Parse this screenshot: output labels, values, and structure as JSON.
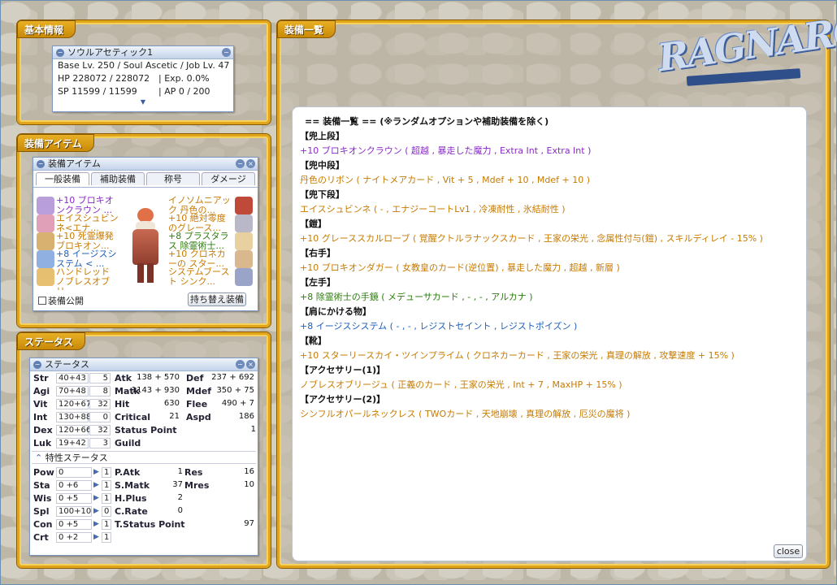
{
  "basic": {
    "frame_title": "基本情報",
    "window_title": "ソウルアセティック1",
    "lines": [
      "Base Lv. 250 / Soul Ascetic / Job Lv. 47",
      "HP 228072 / 228072",
      "| Exp. 0.0%",
      "SP 11599 / 11599",
      "| AP 0 / 200"
    ]
  },
  "equip_item": {
    "frame_title": "装備アイテム",
    "window_title": "装備アイテム",
    "tabs": [
      "一般装備",
      "補助装備",
      "称号",
      "ダメージ"
    ],
    "left_items": [
      {
        "text": "+10 ブロキオンクラウン ...",
        "color": "#8a2ac8",
        "icon": "crown-icon"
      },
      {
        "text": "エイスシュビンネ<エナ...",
        "color": "#c77a00",
        "icon": "ribbon-icon"
      },
      {
        "text": "+10 死霊爆発ブロキオン...",
        "color": "#c77a00",
        "icon": "dagger-icon"
      },
      {
        "text": "+8 イージスシステム < ...",
        "color": "#1f60b8",
        "icon": "cape-icon"
      },
      {
        "text": "ハンドレッド ノブレスオブリ...",
        "color": "#c77a00",
        "icon": "ring-icon"
      }
    ],
    "right_items": [
      {
        "text": "イノソムニアック 丹色の...",
        "color": "#c77a00",
        "icon": "robe-icon"
      },
      {
        "text": "+10 絶対零度のグレース...",
        "color": "#c77a00",
        "icon": "armor-icon"
      },
      {
        "text": "+8 プラスタラス 除霊術士...",
        "color": "#2e7d10",
        "icon": "glove-icon"
      },
      {
        "text": "+10 クロネカーの スター...",
        "color": "#c77a00",
        "icon": "shoe-icon"
      },
      {
        "text": "システムブースト シンク...",
        "color": "#c77a00",
        "icon": "necklace-icon"
      }
    ],
    "public_label": "装備公開",
    "switch_button": "持ち替え装備"
  },
  "status": {
    "frame_title": "ステータス",
    "window_title": "ステータス",
    "base_stats": [
      {
        "name": "Str",
        "value": "40+43",
        "bonus": "5"
      },
      {
        "name": "Agi",
        "value": "70+48",
        "bonus": "8"
      },
      {
        "name": "Vit",
        "value": "120+67",
        "bonus": "32"
      },
      {
        "name": "Int",
        "value": "130+88",
        "bonus": "0"
      },
      {
        "name": "Dex",
        "value": "120+66",
        "bonus": "32"
      },
      {
        "name": "Luk",
        "value": "19+42",
        "bonus": "3"
      }
    ],
    "derived": [
      {
        "name": "Atk",
        "value": "138 + 570"
      },
      {
        "name": "Matk",
        "value": "1143 + 930"
      },
      {
        "name": "Hit",
        "value": "630"
      },
      {
        "name": "Critical",
        "value": "21"
      },
      {
        "name": "Status Point",
        "value": "1"
      },
      {
        "name": "Guild",
        "value": ""
      }
    ],
    "derived2": [
      {
        "name": "Def",
        "value": "237 + 692"
      },
      {
        "name": "Mdef",
        "value": "350 + 75"
      },
      {
        "name": "Flee",
        "value": "490 + 7"
      },
      {
        "name": "Aspd",
        "value": "186"
      }
    ],
    "trait_title": "特性ステータス",
    "trait_stats": [
      {
        "name": "Pow",
        "value": "0",
        "bonus": "1"
      },
      {
        "name": "Sta",
        "value": "0 +6",
        "bonus": "1"
      },
      {
        "name": "Wis",
        "value": "0 +5",
        "bonus": "1"
      },
      {
        "name": "Spl",
        "value": "100+10",
        "bonus": "0"
      },
      {
        "name": "Con",
        "value": "0 +5",
        "bonus": "1"
      },
      {
        "name": "Crt",
        "value": "0 +2",
        "bonus": "1"
      }
    ],
    "trait_derived": [
      {
        "name": "P.Atk",
        "value": "1"
      },
      {
        "name": "S.Matk",
        "value": "37"
      },
      {
        "name": "H.Plus",
        "value": "2"
      },
      {
        "name": "C.Rate",
        "value": "0"
      },
      {
        "name": "T.Status Point",
        "value": "97"
      }
    ],
    "trait_derived2": [
      {
        "name": "Res",
        "value": "16"
      },
      {
        "name": "Mres",
        "value": "10"
      }
    ]
  },
  "equip_list": {
    "frame_title": "装備一覧",
    "header": "== 装備一覧 == (※ランダムオプションや補助装備を除く)",
    "entries": [
      {
        "slot": "【兜上段】",
        "text": "+10 ブロキオンクラウン ( 超越 , 暴走した魔力 , Extra Int , Extra Int )",
        "cls": "p"
      },
      {
        "slot": "【兜中段】",
        "text": "丹色のリボン ( ナイトメアカード , Vit + 5 , Mdef + 10 , Mdef + 10 )",
        "cls": "o"
      },
      {
        "slot": "【兜下段】",
        "text": "エイスシュビンネ ( - , エナジーコートLv1 , 冷凍耐性 , 氷結耐性 )",
        "cls": "o"
      },
      {
        "slot": "【鎧】",
        "text": "+10 グレーススカルローブ ( 覚醒クトルラナックスカード , 王家の栄光 , 念属性付与(鎧) , スキルディレイ - 15% )",
        "cls": "o"
      },
      {
        "slot": "【右手】",
        "text": "+10 ブロキオンダガー ( 女教皇のカード(逆位置) , 暴走した魔力 , 超越 , 新層 )",
        "cls": "o"
      },
      {
        "slot": "【左手】",
        "text": "+8 除霊術士の手鏡 ( メデューサカード , - , - , アルカナ )",
        "cls": "g"
      },
      {
        "slot": "【肩にかける物】",
        "text": "+8 イージスシステム ( - , - , レジストセイント , レジストポイズン )",
        "cls": "b"
      },
      {
        "slot": "【靴】",
        "text": "+10 スターリースカイ・ツインプライム ( クロネカーカード , 王家の栄光 , 真理の解放 , 攻撃速度 + 15% )",
        "cls": "o"
      },
      {
        "slot": "【アクセサリー(1)】",
        "text": "ノブレスオブリージュ ( 正義のカード , 王家の栄光 , Int + 7 , MaxHP + 15% )",
        "cls": "o"
      },
      {
        "slot": "【アクセサリー(2)】",
        "text": "シンフルオパールネックレス ( TWOカード , 天地崩壊 , 真理の解放 , 厄災の魔将 )",
        "cls": "o"
      }
    ],
    "close_button": "close"
  }
}
